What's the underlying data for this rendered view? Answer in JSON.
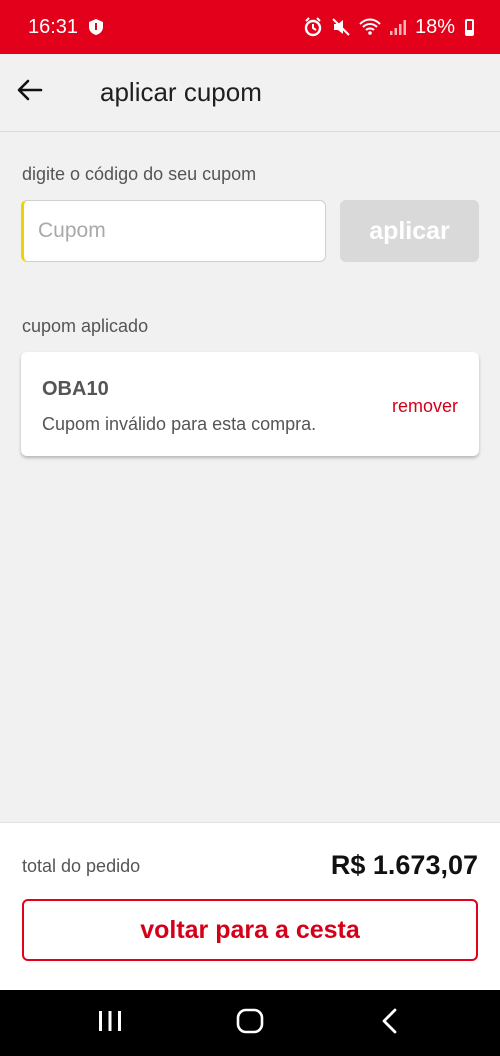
{
  "status_bar": {
    "time": "16:31",
    "battery": "18%",
    "icons": [
      "shield-icon",
      "alarm-icon",
      "mute-icon",
      "wifi-icon",
      "signal-icon",
      "battery-icon"
    ]
  },
  "app_bar": {
    "title": "aplicar cupom",
    "back_icon": "arrow-left-icon"
  },
  "coupon_form": {
    "label": "digite o código do seu cupom",
    "input_placeholder": "Cupom",
    "input_value": "",
    "apply_label": "aplicar"
  },
  "applied_section": {
    "label": "cupom aplicado",
    "coupon": {
      "code": "OBA10",
      "message": "Cupom inválido para esta compra.",
      "remove_label": "remover"
    }
  },
  "footer": {
    "total_label": "total do pedido",
    "total_value": "R$ 1.673,07",
    "button_label": "voltar para a cesta"
  },
  "nav_bar": {
    "icons": [
      "recent-apps-icon",
      "home-icon",
      "back-icon"
    ]
  },
  "colors": {
    "brand_red": "#e2001a",
    "disabled_button": "#d9d9d9",
    "background": "#f1f1f1"
  }
}
